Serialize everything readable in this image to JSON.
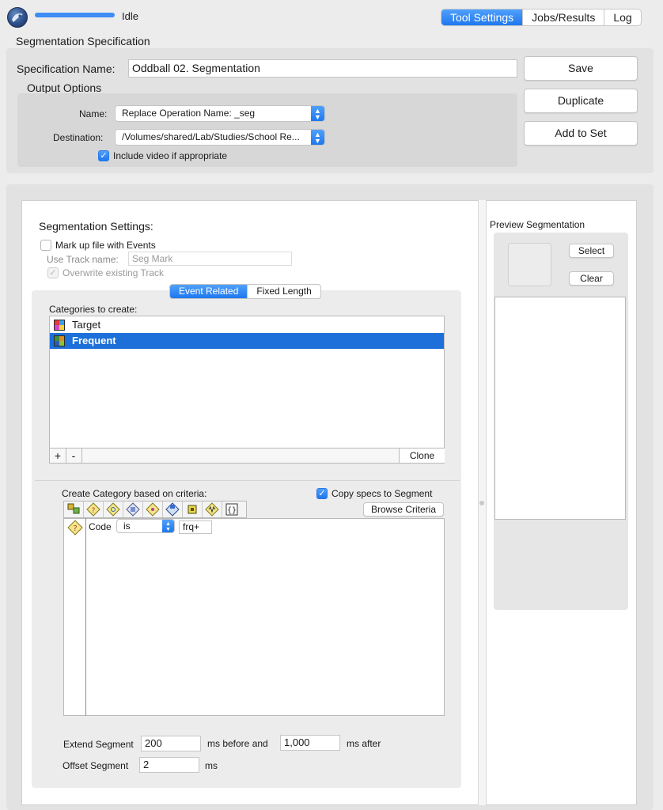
{
  "header": {
    "status": "Idle",
    "progress": 1.0,
    "tabs": [
      {
        "label": "Tool Settings",
        "active": true
      },
      {
        "label": "Jobs/Results",
        "active": false
      },
      {
        "label": "Log",
        "active": false
      }
    ]
  },
  "spec": {
    "section_title": "Segmentation Specification",
    "name_label": "Specification Name:",
    "name_value": "Oddball 02. Segmentation",
    "buttons": {
      "save": "Save",
      "duplicate": "Duplicate",
      "add_to_set": "Add to Set"
    },
    "output": {
      "title": "Output Options",
      "name_label": "Name:",
      "name_value": "Replace Operation Name: _seg",
      "destination_label": "Destination:",
      "destination_value": "/Volumes/shared/Lab/Studies/School Re...",
      "include_video_label": "Include video if appropriate",
      "include_video_checked": true
    }
  },
  "settings": {
    "title": "Segmentation Settings:",
    "markup_label": "Mark up file with Events",
    "markup_checked": false,
    "track_label": "Use Track name:",
    "track_placeholder": "Seg Mark",
    "overwrite_label": "Overwrite existing Track",
    "overwrite_checked": true,
    "tabs": [
      {
        "label": "Event Related",
        "active": true
      },
      {
        "label": "Fixed Length",
        "active": false
      }
    ],
    "categories_label": "Categories to create:",
    "categories": [
      {
        "label": "Target",
        "selected": false
      },
      {
        "label": "Frequent",
        "selected": true
      }
    ],
    "add_symbol": "+",
    "remove_symbol": "-",
    "clone_label": "Clone",
    "criteria_label": "Create Category based on criteria:",
    "copy_specs_label": "Copy specs to Segment",
    "copy_specs_checked": true,
    "browse_label": "Browse Criteria",
    "criterion": {
      "field": "Code",
      "operator": "is",
      "value": "frq+"
    },
    "extend_label": "Extend Segment",
    "extend_before": "200",
    "before_label": "ms before and",
    "extend_after": "1,000",
    "after_label": "ms after",
    "offset_label": "Offset Segment",
    "offset_value": "2",
    "offset_unit": "ms"
  },
  "preview": {
    "title": "Preview Segmentation",
    "select_label": "Select",
    "clear_label": "Clear"
  },
  "colors": {
    "accent": "#1f77ef",
    "selection": "#1d6fd9"
  }
}
